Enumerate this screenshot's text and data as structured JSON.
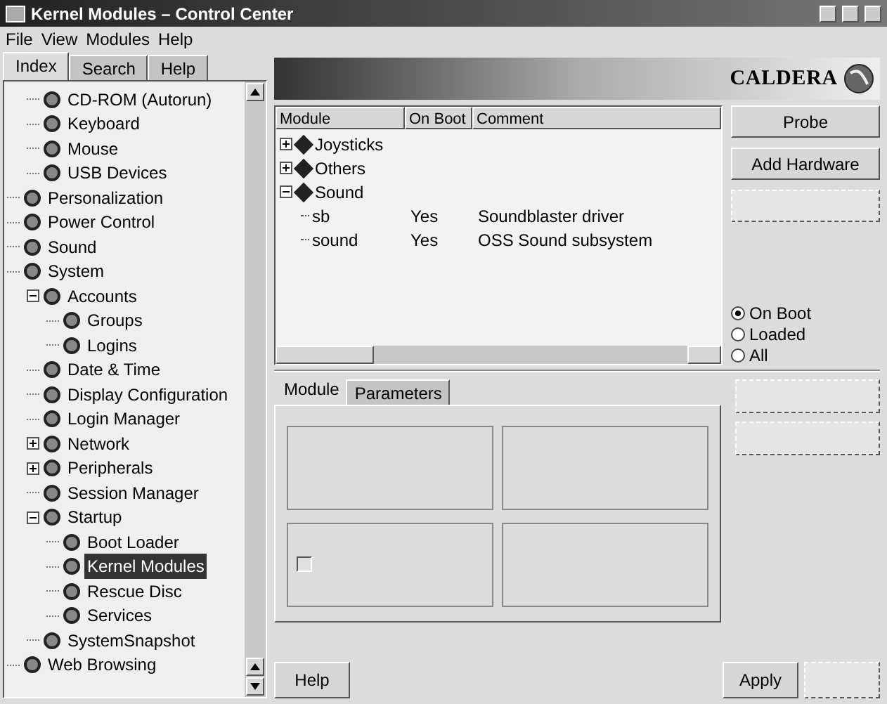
{
  "window": {
    "title": "Kernel Modules – Control Center"
  },
  "menu": [
    "File",
    "View",
    "Modules",
    "Help"
  ],
  "side_tabs": [
    {
      "label": "Index",
      "selected": true
    },
    {
      "label": "Search",
      "selected": false
    },
    {
      "label": "Help",
      "selected": false
    }
  ],
  "tree": [
    {
      "children": [
        {
          "label": "CD-ROM (Autorun)",
          "selected": false
        },
        {
          "label": "Keyboard",
          "selected": false
        },
        {
          "label": "Mouse",
          "selected": false
        },
        {
          "label": "USB Devices",
          "selected": false
        }
      ]
    },
    {
      "label": "Personalization",
      "selected": false
    },
    {
      "label": "Power Control",
      "selected": false
    },
    {
      "label": "Sound",
      "selected": false
    },
    {
      "label": "System",
      "selected": false,
      "children": [
        {
          "label": "Accounts",
          "selected": false,
          "expanded": true,
          "children": [
            {
              "label": "Groups",
              "selected": false
            },
            {
              "label": "Logins",
              "selected": false
            }
          ]
        },
        {
          "label": "Date & Time",
          "selected": false
        },
        {
          "label": "Display Configuration",
          "selected": false
        },
        {
          "label": "Login Manager",
          "selected": false
        },
        {
          "label": "Network",
          "selected": false,
          "expanded": false
        },
        {
          "label": "Peripherals",
          "selected": false,
          "expanded": false
        },
        {
          "label": "Session Manager",
          "selected": false
        },
        {
          "label": "Startup",
          "selected": false,
          "expanded": true,
          "children": [
            {
              "label": "Boot Loader",
              "selected": false
            },
            {
              "label": "Kernel Modules",
              "selected": true
            },
            {
              "label": "Rescue Disc",
              "selected": false
            },
            {
              "label": "Services",
              "selected": false
            }
          ]
        },
        {
          "label": "SystemSnapshot",
          "selected": false
        }
      ]
    },
    {
      "label": "Web Browsing",
      "selected": false
    }
  ],
  "banner": {
    "logo": "CALDERA"
  },
  "modules": {
    "columns": [
      "Module",
      "On Boot",
      "Comment"
    ],
    "rows": [
      {
        "name": "Joysticks",
        "expanded": false
      },
      {
        "name": "Others",
        "expanded": false
      },
      {
        "name": "Sound",
        "expanded": true,
        "children": [
          {
            "name": "sb",
            "on_boot": "Yes",
            "comment": "Soundblaster driver"
          },
          {
            "name": "sound",
            "on_boot": "Yes",
            "comment": "OSS Sound subsystem"
          }
        ]
      }
    ]
  },
  "side_buttons": [
    {
      "label": "Probe",
      "disabled": false
    },
    {
      "label": "Add Hardware",
      "disabled": false
    },
    {
      "disabled": true
    }
  ],
  "filter": [
    {
      "label": "On Boot",
      "selected": true
    },
    {
      "label": "Loaded",
      "selected": false
    },
    {
      "label": "All",
      "selected": false
    }
  ],
  "detail_tabs": [
    {
      "label": "Module",
      "selected": true
    },
    {
      "label": "Parameters",
      "selected": false
    }
  ],
  "detail_buttons": [
    {
      "disabled": true
    },
    {
      "disabled": true
    }
  ],
  "detail_checkbox": {
    "checked": false
  },
  "footer_buttons": [
    {
      "label": "Help",
      "disabled": false
    },
    {
      "label": "Apply",
      "disabled": false
    },
    {
      "disabled": true
    }
  ]
}
